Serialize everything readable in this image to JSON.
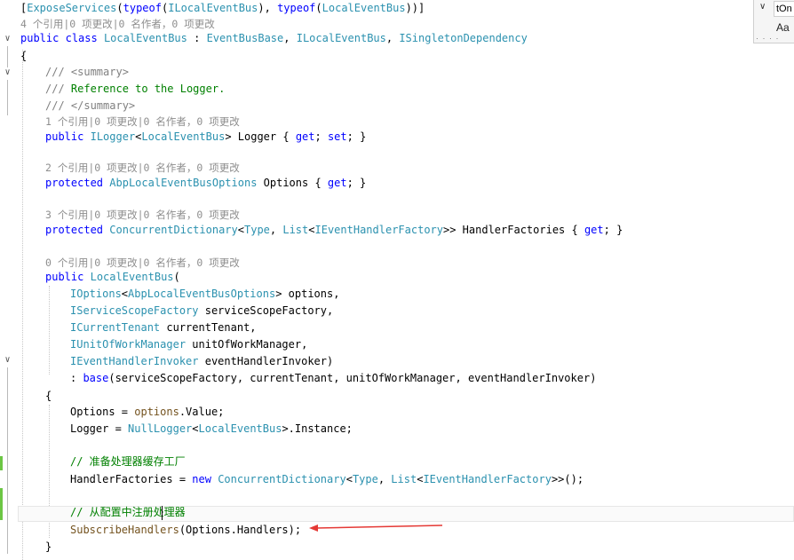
{
  "find_widget": {
    "search_text": "tOn",
    "match_case_label": "Aa"
  },
  "lines": [
    [
      "[",
      {
        "c": "ty",
        "t": "ExposeServices"
      },
      "(",
      {
        "c": "kw",
        "t": "typeof"
      },
      "(",
      {
        "c": "ty",
        "t": "ILocalEventBus"
      },
      "), ",
      {
        "c": "kw",
        "t": "typeof"
      },
      "(",
      {
        "c": "ty",
        "t": "LocalEventBus"
      },
      "))]"
    ],
    [
      {
        "c": "lens",
        "t": "4 个引用|0 项更改|0 名作者，0 项更改"
      }
    ],
    [
      {
        "c": "kw",
        "t": "public"
      },
      " ",
      {
        "c": "kw",
        "t": "class"
      },
      " ",
      {
        "c": "ty",
        "t": "LocalEventBus"
      },
      " : ",
      {
        "c": "ty",
        "t": "EventBusBase"
      },
      ", ",
      {
        "c": "ty",
        "t": "ILocalEventBus"
      },
      ", ",
      {
        "c": "ty",
        "t": "ISingletonDependency"
      }
    ],
    [
      "{"
    ],
    [
      {
        "c": "cmx",
        "t": "/// <summary>"
      }
    ],
    [
      {
        "c": "cmx",
        "t": "/// "
      },
      {
        "c": "cm",
        "t": "Reference to the Logger."
      }
    ],
    [
      {
        "c": "cmx",
        "t": "/// </summary>"
      }
    ],
    [
      {
        "c": "lens",
        "t": "1 个引用|0 项更改|0 名作者，0 项更改"
      }
    ],
    [
      {
        "c": "kw",
        "t": "public"
      },
      " ",
      {
        "c": "ty",
        "t": "ILogger"
      },
      "<",
      {
        "c": "ty",
        "t": "LocalEventBus"
      },
      "> Logger { ",
      {
        "c": "kw",
        "t": "get"
      },
      "; ",
      {
        "c": "kw",
        "t": "set"
      },
      "; }"
    ],
    [
      ""
    ],
    [
      {
        "c": "lens",
        "t": "2 个引用|0 项更改|0 名作者，0 项更改"
      }
    ],
    [
      {
        "c": "kw",
        "t": "protected"
      },
      " ",
      {
        "c": "ty",
        "t": "AbpLocalEventBusOptions"
      },
      " Options { ",
      {
        "c": "kw",
        "t": "get"
      },
      "; }"
    ],
    [
      ""
    ],
    [
      {
        "c": "lens",
        "t": "3 个引用|0 项更改|0 名作者，0 项更改"
      }
    ],
    [
      {
        "c": "kw",
        "t": "protected"
      },
      " ",
      {
        "c": "ty",
        "t": "ConcurrentDictionary"
      },
      "<",
      {
        "c": "ty",
        "t": "Type"
      },
      ", ",
      {
        "c": "ty",
        "t": "List"
      },
      "<",
      {
        "c": "ty",
        "t": "IEventHandlerFactory"
      },
      ">> HandlerFactories { ",
      {
        "c": "kw",
        "t": "get"
      },
      "; }"
    ],
    [
      ""
    ],
    [
      {
        "c": "lens",
        "t": "0 个引用|0 项更改|0 名作者，0 项更改"
      }
    ],
    [
      {
        "c": "kw",
        "t": "public"
      },
      " ",
      {
        "c": "ty",
        "t": "LocalEventBus"
      },
      "("
    ],
    [
      {
        "c": "ty",
        "t": "IOptions"
      },
      "<",
      {
        "c": "ty",
        "t": "AbpLocalEventBusOptions"
      },
      "> options,"
    ],
    [
      {
        "c": "ty",
        "t": "IServiceScopeFactory"
      },
      " serviceScopeFactory,"
    ],
    [
      {
        "c": "ty",
        "t": "ICurrentTenant"
      },
      " currentTenant,"
    ],
    [
      {
        "c": "ty",
        "t": "IUnitOfWorkManager"
      },
      " unitOfWorkManager,"
    ],
    [
      {
        "c": "ty",
        "t": "IEventHandlerInvoker"
      },
      " eventHandlerInvoker)"
    ],
    [
      ": ",
      {
        "c": "kw",
        "t": "base"
      },
      "(serviceScopeFactory, currentTenant, unitOfWorkManager, eventHandlerInvoker)"
    ],
    [
      "{"
    ],
    [
      "Options = ",
      {
        "c": "mt",
        "t": "options"
      },
      ".Value;"
    ],
    [
      "Logger = ",
      {
        "c": "ty",
        "t": "NullLogger"
      },
      "<",
      {
        "c": "ty",
        "t": "LocalEventBus"
      },
      ">.Instance;"
    ],
    [
      ""
    ],
    [
      {
        "c": "cm",
        "t": "// 准备处理器缓存工厂"
      }
    ],
    [
      "HandlerFactories = ",
      {
        "c": "kw",
        "t": "new"
      },
      " ",
      {
        "c": "ty",
        "t": "ConcurrentDictionary"
      },
      "<",
      {
        "c": "ty",
        "t": "Type"
      },
      ", ",
      {
        "c": "ty",
        "t": "List"
      },
      "<",
      {
        "c": "ty",
        "t": "IEventHandlerFactory"
      },
      ">>();"
    ],
    [
      ""
    ],
    [
      {
        "c": "cm",
        "t": "// 从配置中注册处理器"
      }
    ],
    [
      {
        "c": "mt",
        "t": "SubscribeHandlers"
      },
      "(Options.Handlers);"
    ],
    [
      "}"
    ]
  ]
}
